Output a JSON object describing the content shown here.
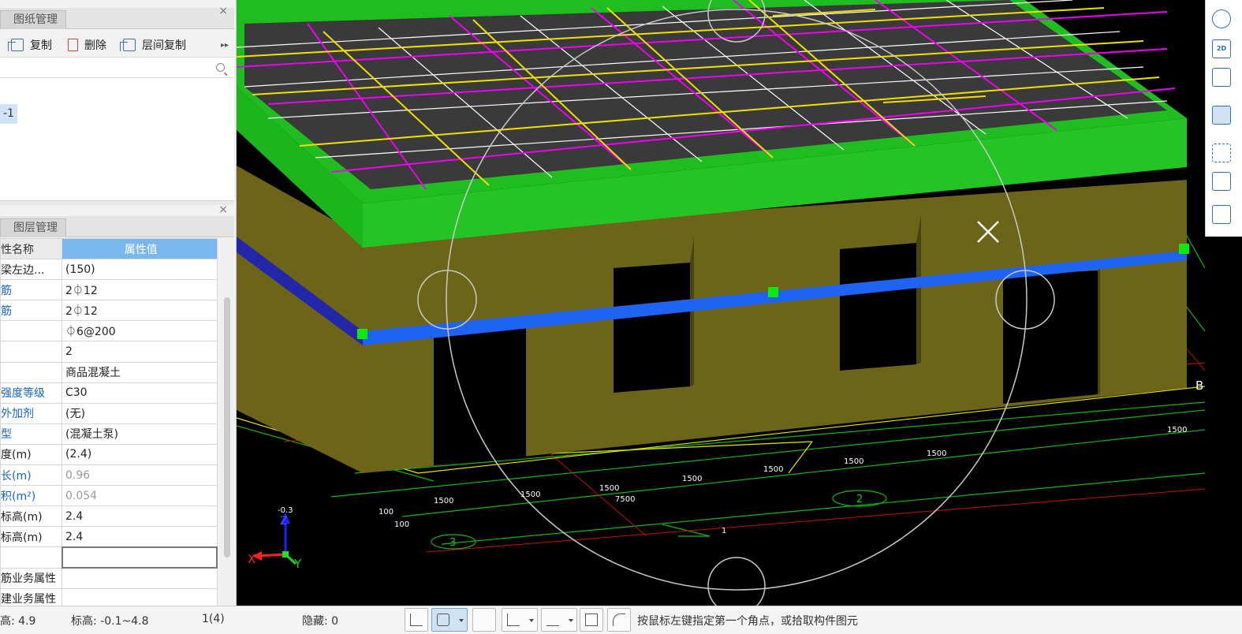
{
  "drawing_panel": {
    "tab": "图纸管理",
    "close": "×",
    "toolbar": {
      "copy": "复制",
      "delete": "删除",
      "floor_copy": "层间复制",
      "more": "▸▸"
    },
    "floor_item": "-1"
  },
  "layer_panel": {
    "tab": "图层管理",
    "close": "×"
  },
  "properties": {
    "header_name": "性名称",
    "header_value": "属性值",
    "rows": [
      {
        "name": "梁左边...",
        "value": "(150)",
        "name_blue": false,
        "gray": false
      },
      {
        "name": "筋",
        "value": "2⏀12",
        "name_blue": true,
        "gray": false
      },
      {
        "name": "筋",
        "value": "2⏀12",
        "name_blue": true,
        "gray": false
      },
      {
        "name": "",
        "value": "⏀6@200",
        "name_blue": false,
        "gray": false
      },
      {
        "name": "",
        "value": "2",
        "name_blue": false,
        "gray": false
      },
      {
        "name": "",
        "value": "商品混凝土",
        "name_blue": false,
        "gray": false
      },
      {
        "name": "强度等级",
        "value": "C30",
        "name_blue": true,
        "gray": false
      },
      {
        "name": "外加剂",
        "value": "(无)",
        "name_blue": true,
        "gray": false
      },
      {
        "name": "型",
        "value": "(混凝土泵)",
        "name_blue": true,
        "gray": false
      },
      {
        "name": "度(m)",
        "value": "(2.4)",
        "name_blue": false,
        "gray": false
      },
      {
        "name": "长(m)",
        "value": "0.96",
        "name_blue": true,
        "gray": true
      },
      {
        "name": "积(m²)",
        "value": "0.054",
        "name_blue": true,
        "gray": true
      },
      {
        "name": "标高(m)",
        "value": "2.4",
        "name_blue": false,
        "gray": false
      },
      {
        "name": "标高(m)",
        "value": "2.4",
        "name_blue": false,
        "gray": false
      },
      {
        "name": "",
        "value": "",
        "name_blue": false,
        "gray": false
      },
      {
        "name": "筋业务属性",
        "value": "",
        "name_blue": false,
        "gray": false
      },
      {
        "name": "建业务属性",
        "value": "",
        "name_blue": false,
        "gray": false
      }
    ]
  },
  "viewport": {
    "axis_x": "X",
    "axis_y": "Y",
    "axis_z": "Z",
    "axis_tag_b": "B",
    "axis_tag_2": "2",
    "axis_tag_3": "3",
    "dim_labels": [
      "1500",
      "1500",
      "1500",
      "1500",
      "1500",
      "1500",
      "1500",
      "1500"
    ],
    "dim_total": "7500",
    "dim_100a": "100",
    "dim_100b": "100",
    "small_1": "1",
    "level_tag": "-0.3"
  },
  "statusbar": {
    "floor_height": "高:  4.9",
    "elevation": "标高:  -0.1~4.8",
    "count": "1(4)",
    "hidden": "隐藏:  0",
    "hint": "按鼠标左键指定第一个角点，或拾取构件图元"
  },
  "right_tools": {
    "label_2d": "2D"
  }
}
